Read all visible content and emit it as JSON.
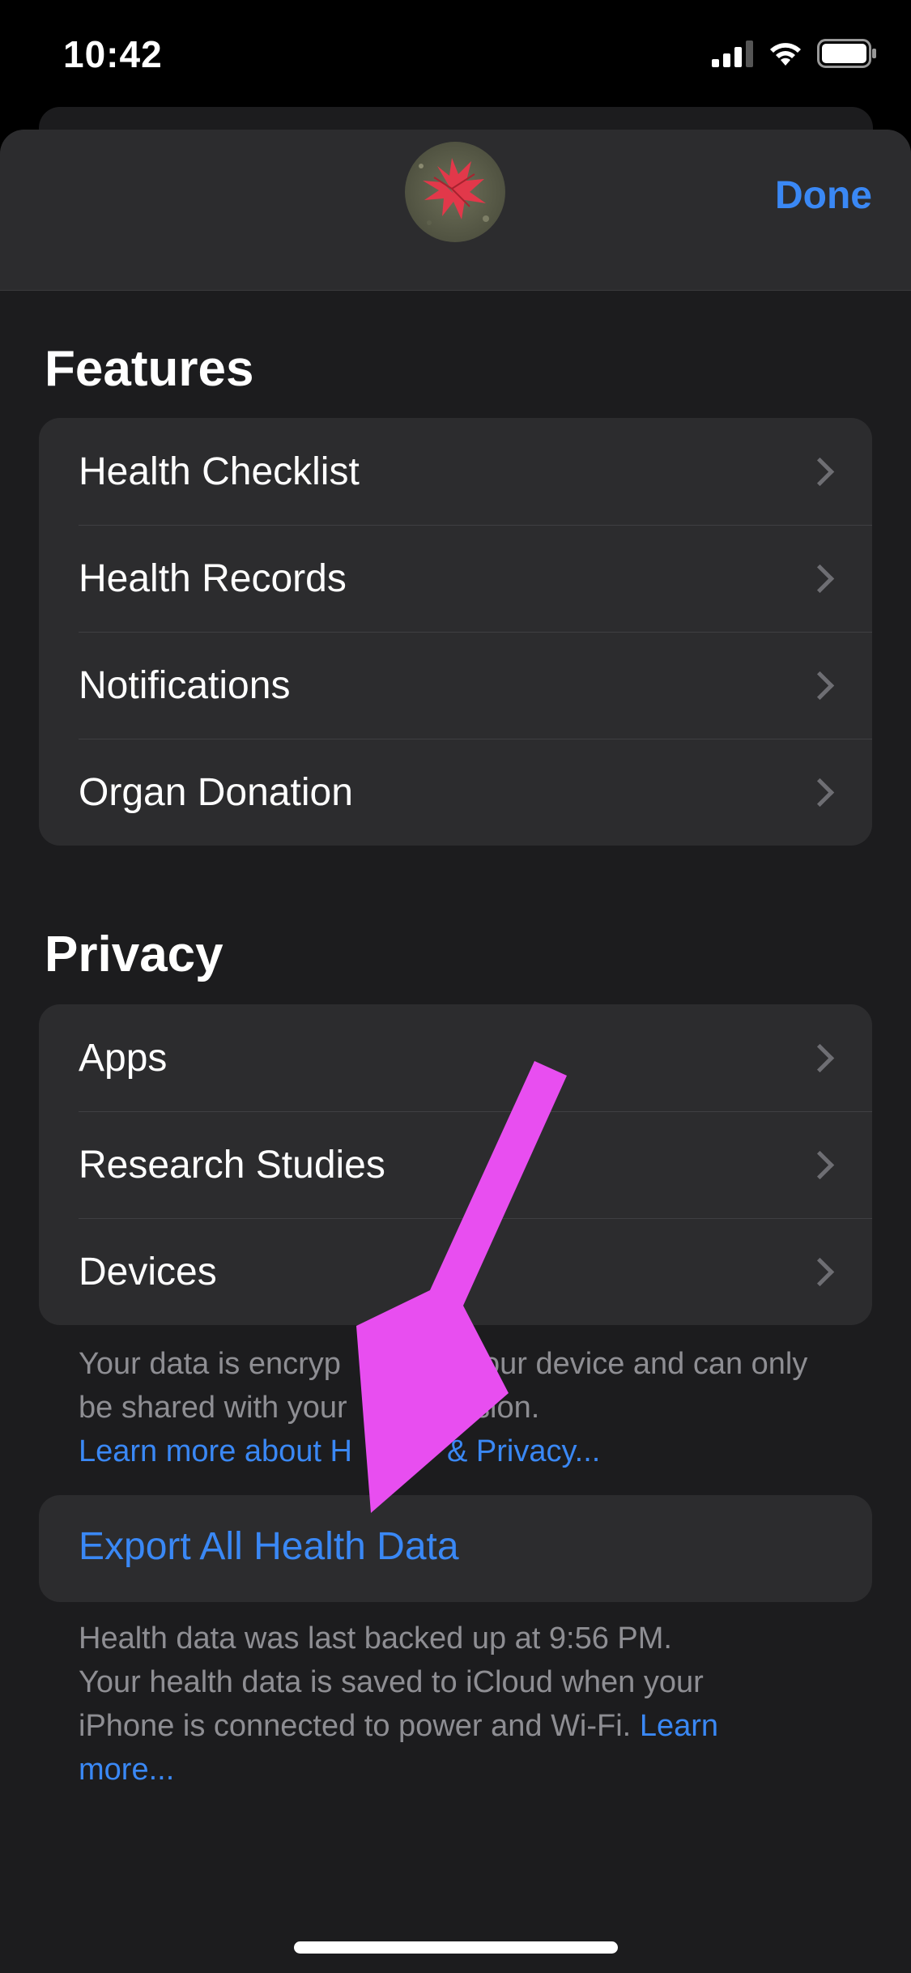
{
  "status_bar": {
    "time": "10:42",
    "icons": [
      "cellular-signal-icon",
      "wifi-icon",
      "battery-icon"
    ]
  },
  "header": {
    "avatar_icon": "red-leaf-avatar",
    "done_label": "Done"
  },
  "features": {
    "title": "Features",
    "items": [
      {
        "label": "Health Checklist"
      },
      {
        "label": "Health Records"
      },
      {
        "label": "Notifications"
      },
      {
        "label": "Organ Donation"
      }
    ]
  },
  "privacy": {
    "title": "Privacy",
    "items": [
      {
        "label": "Apps"
      },
      {
        "label": "Research Studies"
      },
      {
        "label": "Devices"
      }
    ],
    "footnote_line1": "Your data is encryp",
    "footnote_line1_end": "your device and can only",
    "footnote_line2": "be shared with your",
    "footnote_line2_end": "ssion.",
    "link_text_start": "Learn more about H",
    "link_text_end": "& Privacy..."
  },
  "export": {
    "label": "Export All Health Data",
    "footnote_line1": "Health data was last backed up at 9:56 PM.",
    "footnote_line2": "Your health data is saved to iCloud when your",
    "footnote_line3": "iPhone is connected to power and Wi-Fi.",
    "link_learn": "Learn",
    "link_more": "more..."
  },
  "colors": {
    "accent": "#3a88f5",
    "annotation_arrow": "#e84ef0",
    "background": "#1c1c1e",
    "cell": "#2c2c2e"
  }
}
